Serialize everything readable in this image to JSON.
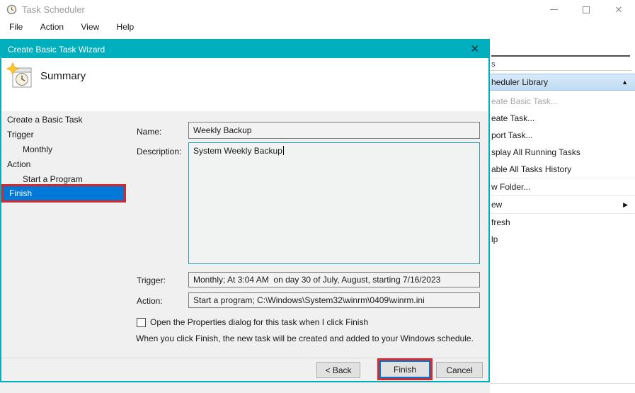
{
  "window": {
    "title": "Task Scheduler",
    "menu": [
      "File",
      "Action",
      "View",
      "Help"
    ],
    "close_glyph": "✕"
  },
  "dialog": {
    "title": "Create Basic Task Wizard",
    "close_glyph": "✕",
    "step_title": "Summary",
    "steps": [
      {
        "label": "Create a Basic Task"
      },
      {
        "label": "Trigger"
      },
      {
        "label": "Monthly"
      },
      {
        "label": "Action"
      },
      {
        "label": "Start a Program"
      },
      {
        "label": "Finish"
      }
    ],
    "form": {
      "name_label": "Name:",
      "name_value": "Weekly Backup",
      "description_label": "Description:",
      "description_value": "System Weekly Backup",
      "trigger_label": "Trigger:",
      "trigger_value": "Monthly; At 3:04 AM  on day 30 of July, August, starting 7/16/2023",
      "action_label": "Action:",
      "action_value": "Start a program; C:\\Windows\\System32\\winrm\\0409\\winrm.ini"
    },
    "checkbox_label": "Open the Properties dialog for this task when I click Finish",
    "footer_note": "When you click Finish, the new task will be created and added to your Windows schedule.",
    "buttons": {
      "back": "< Back",
      "finish": "Finish",
      "cancel": "Cancel"
    }
  },
  "actions_panel": {
    "header_fragment": "s",
    "group_header": "heduler Library",
    "collapse_glyph": "▲",
    "submenu_glyph": "▶",
    "items": [
      "eate Basic Task...",
      "eate Task...",
      "port Task...",
      "splay All Running Tasks",
      "able All Tasks History",
      "w Folder...",
      "ew",
      "fresh",
      "lp"
    ]
  },
  "colors": {
    "accent_teal": "#00AFBE",
    "selection_blue": "#0078D7",
    "annotation_red": "#D32B2B",
    "focus_border": "#2E9BB5"
  }
}
